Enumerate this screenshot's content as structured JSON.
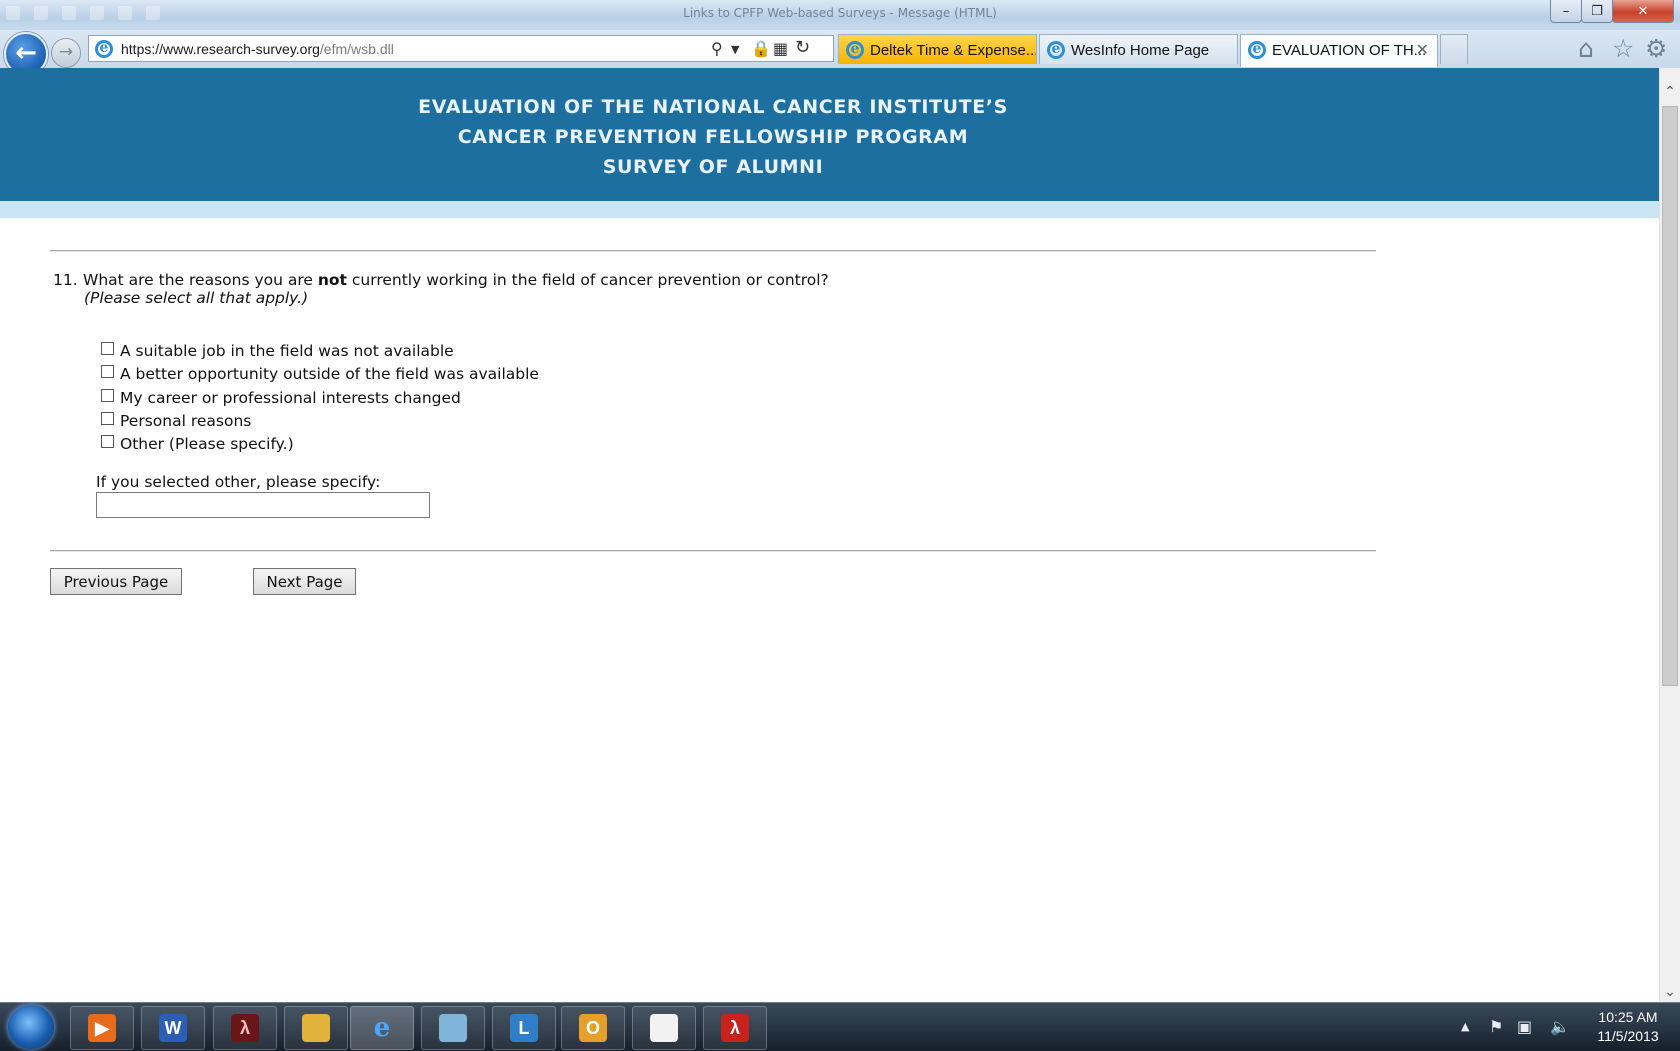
{
  "window": {
    "title": "Links to CPFP Web-based Surveys - Message (HTML)",
    "controls": {
      "minimize": "–",
      "maximize": "❐",
      "close": "✕"
    }
  },
  "browser": {
    "back_icon": "back-arrow-icon",
    "forward_icon": "forward-arrow-icon",
    "address": {
      "host": "https://www.research-survey.org",
      "path": "/efm/wsb.dll"
    },
    "tabs": [
      {
        "label": "Deltek Time & Expense...",
        "active": false,
        "color": "#f5b400"
      },
      {
        "label": "WesInfo Home Page",
        "active": false
      },
      {
        "label": "EVALUATION OF TH...",
        "active": true
      }
    ],
    "tab_close": "✕",
    "toolbar_icons": [
      "home-icon",
      "favorites-star-icon",
      "settings-gear-icon"
    ]
  },
  "banner": {
    "lines": [
      "EVALUATION OF THE NATIONAL CANCER INSTITUTE’S",
      "CANCER PREVENTION FELLOWSHIP PROGRAM",
      "SURVEY OF ALUMNI"
    ],
    "color": "#1d6fa0",
    "strip_color": "#c9e4f2"
  },
  "question": {
    "number": "11.",
    "text_before": "What are the reasons you are ",
    "text_bold": "not",
    "text_after": " currently working in the field of cancer prevention or control?",
    "note": "(Please select all that apply.)",
    "options": [
      {
        "label": "A suitable job in the field was not available",
        "checked": false
      },
      {
        "label": "A better opportunity outside of the field was available",
        "checked": false
      },
      {
        "label": "My career or professional interests changed",
        "checked": false
      },
      {
        "label": "Personal reasons",
        "checked": false
      },
      {
        "label": "Other (Please specify.)",
        "checked": false
      }
    ],
    "other_label": "If you selected other, please specify:",
    "other_value": ""
  },
  "buttons": {
    "previous": "Previous Page",
    "next": "Next Page"
  },
  "taskbar": {
    "apps": [
      "media-player-icon",
      "word-icon",
      "acrobat-icon",
      "folder-icon",
      "internet-explorer-icon",
      "notepad-icon",
      "lync-icon",
      "outlook-icon",
      "blank-document-icon",
      "pdf-icon"
    ],
    "time": "10:25 AM",
    "date": "11/5/2013"
  }
}
